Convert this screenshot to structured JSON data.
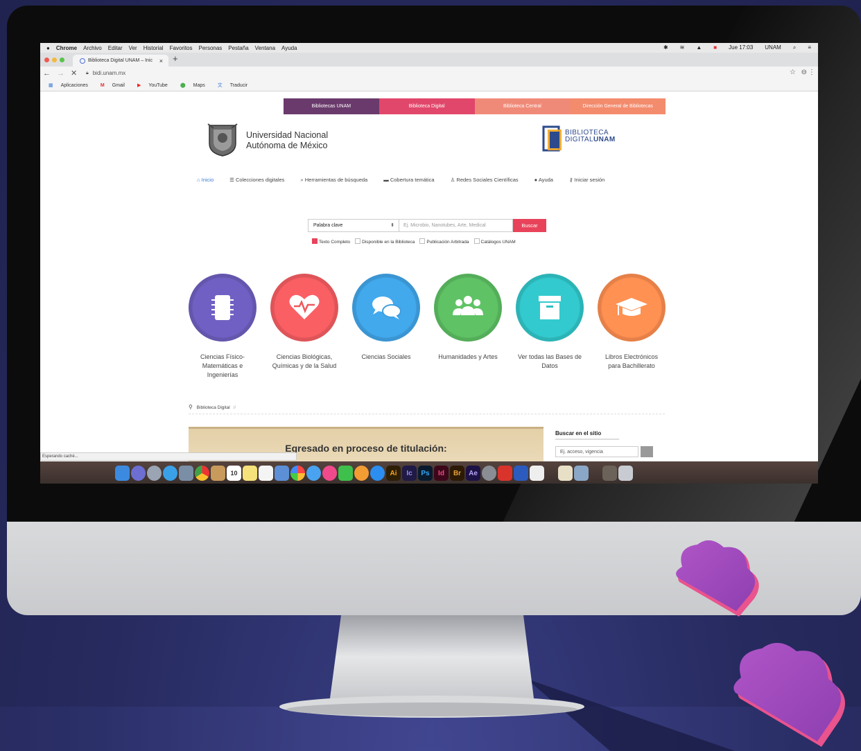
{
  "menubar": {
    "apple": "",
    "items": [
      "Chrome",
      "Archivo",
      "Editar",
      "Ver",
      "Historial",
      "Favoritos",
      "Personas",
      "Pestaña",
      "Ventana",
      "Ayuda"
    ],
    "clock": "Jue 17:03",
    "user": "UNAM"
  },
  "tab": {
    "title": "Biblioteca Digital UNAM – Inic",
    "close": "×",
    "new": "+"
  },
  "address": {
    "url": "bidi.unam.mx",
    "back": "←",
    "forward": "→",
    "reload": "✕"
  },
  "bookmarks": [
    "Aplicaciones",
    "Gmail",
    "YouTube",
    "Maps",
    "Traducir"
  ],
  "topnav": [
    {
      "label": "Bibliotecas UNAM",
      "color": "#6a3a6c"
    },
    {
      "label": "Biblioteca Digital",
      "color": "#e1476a"
    },
    {
      "label": "Biblioteca Central",
      "color": "#f08a78"
    },
    {
      "label": "Dirección General de Bibliotecas",
      "color": "#f38b6d"
    }
  ],
  "header": {
    "unam_line1": "Universidad Nacional",
    "unam_line2": "Autónoma de México",
    "bidi_line1": "BIBLIOTECA",
    "bidi_line2a": "DIGITAL",
    "bidi_line2b": "UNAM"
  },
  "mainnav": [
    "Inicio",
    "Colecciones digitales",
    "Herramientas de búsqueda",
    "Cobertura temática",
    "Redes Sociales Científicas",
    "Ayuda",
    "Iniciar sesión"
  ],
  "search": {
    "select_value": "Palabra clave",
    "placeholder": "Ej. Microbio, Nanotubes, Arte, Medical",
    "button": "Buscar",
    "options": [
      {
        "label": "Texto Completo",
        "checked": true
      },
      {
        "label": "Disponible en la Biblioteca",
        "checked": false
      },
      {
        "label": "Publicación Arbitrada",
        "checked": false
      },
      {
        "label": "Catálogos UNAM",
        "checked": false
      }
    ]
  },
  "categories": [
    {
      "line1": "Ciencias Físico-",
      "line2": "Matemáticas e",
      "line3": "Ingenierías",
      "color": "#6b5bb8",
      "icon": "chip-icon"
    },
    {
      "line1": "Ciencias Biológicas,",
      "line2": "Químicas y de la Salud",
      "line3": "",
      "color": "#ec5a5e",
      "icon": "heartbeat-icon"
    },
    {
      "line1": "Ciencias Sociales",
      "line2": "",
      "line3": "",
      "color": "#3e9fe0",
      "icon": "chat-icon"
    },
    {
      "line1": "Humanidades y Artes",
      "line2": "",
      "line3": "",
      "color": "#5ab85f",
      "icon": "group-icon"
    },
    {
      "line1": "Ver todas las Bases de",
      "line2": "Datos",
      "line3": "",
      "color": "#2fbfc2",
      "icon": "archive-icon"
    },
    {
      "line1": "Libros Electrónicos",
      "line2": "para Bachillerato",
      "line3": "",
      "color": "#f4894d",
      "icon": "graduation-cap-icon"
    }
  ],
  "breadcrumb": {
    "label": "Biblioteca Digital",
    "sep": "//"
  },
  "banner": {
    "title": "Egresado en proceso de titulación:"
  },
  "sidebar": {
    "title": "Buscar en el sitio",
    "placeholder": "Ej. acceso, vigencia"
  },
  "status": {
    "text": "Esperando caché..."
  },
  "dock": {
    "calendar_day": "10",
    "apps": [
      "Ai",
      "Ic",
      "Ps",
      "Id",
      "Br",
      "Ae"
    ]
  }
}
